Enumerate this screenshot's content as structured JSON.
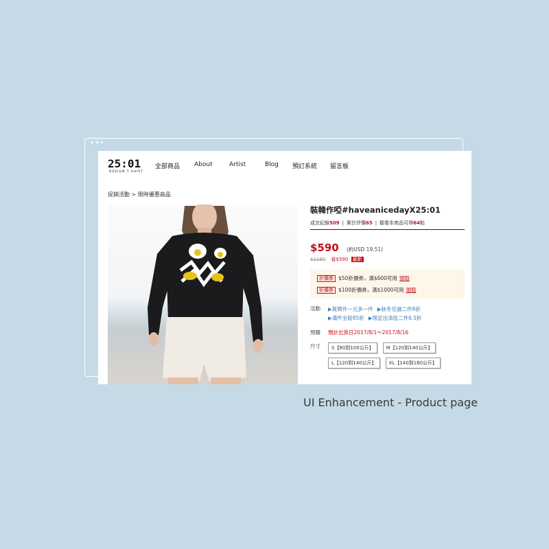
{
  "logo": {
    "main": "25:01",
    "sub": "DESIGN T-SHIRT"
  },
  "nav": [
    "全部商品",
    "About",
    "Artist",
    "Blog",
    "預訂系統",
    "留言板"
  ],
  "breadcrumb": "促銷活動 > 限時優惠商品",
  "product": {
    "title": "裝韓作啞#haveanicedayX25:01",
    "stats": {
      "sold_label": "成交紀錄",
      "sold": "509",
      "rating_label": "累計評價",
      "rating": "65",
      "views_label": "觀看本商品可得",
      "views": "64",
      "views_unit": "點"
    },
    "price": "$590",
    "usd": "(約USD 19.51)",
    "original_price": "$1180",
    "save": "省$590",
    "badge": "最新"
  },
  "coupons": [
    {
      "tag": "折價券",
      "text": "$50折價券，滿$600可用",
      "action": "領取"
    },
    {
      "tag": "折價券",
      "text": "$100折價券，滿$1000可用",
      "action": "領取"
    }
  ],
  "events": {
    "label": "活動",
    "items": [
      "▶買兩件一元多一件",
      "▶秋冬任選二件8折",
      "▶滿件全館85折",
      "▶限定出清區二件6.5折"
    ]
  },
  "preorder": {
    "label": "預購",
    "text": "預計出貨日2017/8/1～2017/8/16"
  },
  "sizes": {
    "label": "尺寸",
    "options": [
      "S【80到100公斤】",
      "M【120到140公斤】",
      "L【120到140公斤】",
      "XL【140到160公斤】"
    ]
  },
  "caption": "UI Enhancement - Product page",
  "colors": {
    "accent": "#c40d1a",
    "background": "#c5dae6",
    "link": "#3f7fbf"
  }
}
